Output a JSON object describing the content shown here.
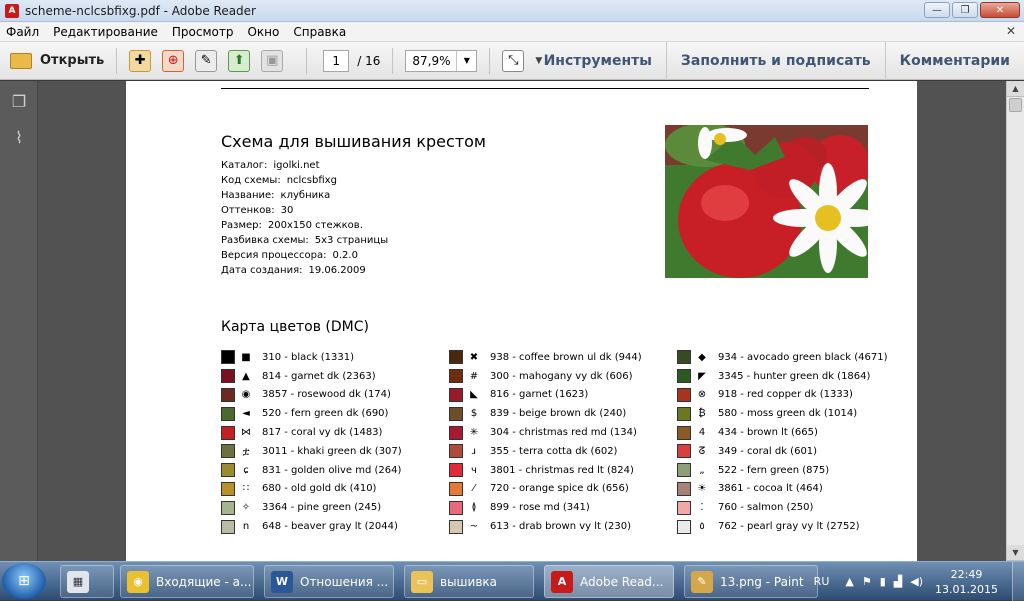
{
  "window": {
    "title": "scheme-nclcsbfixg.pdf - Adobe Reader",
    "app_icon": "adobe-reader-icon"
  },
  "menu": [
    "Файл",
    "Редактирование",
    "Просмотр",
    "Окно",
    "Справка"
  ],
  "toolbar": {
    "open_label": "Открыть",
    "page_current": "1",
    "page_total": "/ 16",
    "zoom": "87,9%",
    "tools_label": "Инструменты",
    "fill_sign_label": "Заполнить и подписать",
    "comments_label": "Комментарии"
  },
  "document": {
    "title": "Схема для вышивания крестом",
    "info": [
      {
        "k": "Каталог:",
        "v": "igolki.net"
      },
      {
        "k": "Код схемы:",
        "v": "nclcsbfixg"
      },
      {
        "k": "Название:",
        "v": "клубника"
      },
      {
        "k": "Оттенков:",
        "v": "30"
      },
      {
        "k": "Размер:",
        "v": "200x150 стежков."
      },
      {
        "k": "Разбивка схемы:",
        "v": "5x3 страницы"
      },
      {
        "k": "Версия процессора:",
        "v": "0.2.0"
      },
      {
        "k": "Дата создания:",
        "v": "19.06.2009"
      }
    ],
    "colors_title": "Карта цветов (DMC)",
    "colors": [
      [
        {
          "sym": "■",
          "color": "#000000",
          "label": "310 - black (1331)"
        },
        {
          "sym": "▲",
          "color": "#7a1020",
          "label": "814 - garnet dk (2363)"
        },
        {
          "sym": "◉",
          "color": "#6e2a22",
          "label": "3857 - rosewood dk (174)"
        },
        {
          "sym": "◄",
          "color": "#4b6a30",
          "label": "520 - fern green dk (690)"
        },
        {
          "sym": "⋈",
          "color": "#c22022",
          "label": "817 - coral vy dk (1483)"
        },
        {
          "sym": "ቷ",
          "color": "#6f7040",
          "label": "3011 - khaki green dk (307)"
        },
        {
          "sym": "ɕ",
          "color": "#9a8a30",
          "label": "831 - golden olive md (264)"
        },
        {
          "sym": "∷",
          "color": "#b8902a",
          "label": "680 - old gold dk (410)"
        },
        {
          "sym": "✧",
          "color": "#a5b48a",
          "label": "3364 - pine green (245)"
        },
        {
          "sym": "ո",
          "color": "#b9bca5",
          "label": "648 - beaver gray lt (2044)"
        }
      ],
      [
        {
          "sym": "✖",
          "color": "#4a2810",
          "label": "938 - coffee brown ul dk (944)"
        },
        {
          "sym": "#",
          "color": "#6e2c10",
          "label": "300 - mahogany vy dk (606)"
        },
        {
          "sym": "◣",
          "color": "#9a1a2a",
          "label": "816 - garnet (1623)"
        },
        {
          "sym": "$",
          "color": "#6e4e28",
          "label": "839 - beige brown dk (240)"
        },
        {
          "sym": "✳",
          "color": "#a81a32",
          "label": "304 - christmas red md (134)"
        },
        {
          "sym": "ɹ",
          "color": "#b04a3a",
          "label": "355 - terra cotta dk (602)"
        },
        {
          "sym": "ч",
          "color": "#e02a3a",
          "label": "3801 - christmas red lt (824)"
        },
        {
          "sym": "⁄",
          "color": "#e8783a",
          "label": "720 - orange spice dk (656)"
        },
        {
          "sym": "≬",
          "color": "#e86a7a",
          "label": "899 - rose md (341)"
        },
        {
          "sym": "~",
          "color": "#d4c8b0",
          "label": "613 - drab brown vy lt (230)"
        }
      ],
      [
        {
          "sym": "◆",
          "color": "#364a24",
          "label": "934 - avocado green black (4671)"
        },
        {
          "sym": "◤",
          "color": "#2e5a22",
          "label": "3345 - hunter green dk (1864)"
        },
        {
          "sym": "⊗",
          "color": "#a8341e",
          "label": "918 - red copper dk (1333)"
        },
        {
          "sym": "₿",
          "color": "#6a7822",
          "label": "580 - moss green dk (1014)"
        },
        {
          "sym": "4",
          "color": "#8a5a28",
          "label": "434 - brown lt (665)"
        },
        {
          "sym": "ᘔ",
          "color": "#d84040",
          "label": "349 - coral dk (601)"
        },
        {
          "sym": "„",
          "color": "#8ea07a",
          "label": "522 - fern green (875)"
        },
        {
          "sym": "☀",
          "color": "#a68278",
          "label": "3861 - cocoa lt (464)"
        },
        {
          "sym": "⁚",
          "color": "#f0a8a8",
          "label": "760 - salmon (250)"
        },
        {
          "sym": "٥",
          "color": "#eaeaea",
          "label": "762 - pearl gray vy lt (2752)"
        }
      ]
    ]
  },
  "taskbar": {
    "apps": [
      {
        "label": "Входящие - а...",
        "icon": "chrome-icon",
        "color": "#e8c030"
      },
      {
        "label": "Отношения ...",
        "icon": "word-icon",
        "color": "#2b5797"
      },
      {
        "label": "вышивка",
        "icon": "folder-icon",
        "color": "#e9c35a"
      },
      {
        "label": "Adobe Read...",
        "icon": "adobe-reader-icon",
        "color": "#c8191b"
      },
      {
        "label": "13.png - Paint",
        "icon": "paint-icon",
        "color": "#d4a84a"
      }
    ],
    "lang": "RU",
    "time": "22:49",
    "date": "13.01.2015"
  }
}
